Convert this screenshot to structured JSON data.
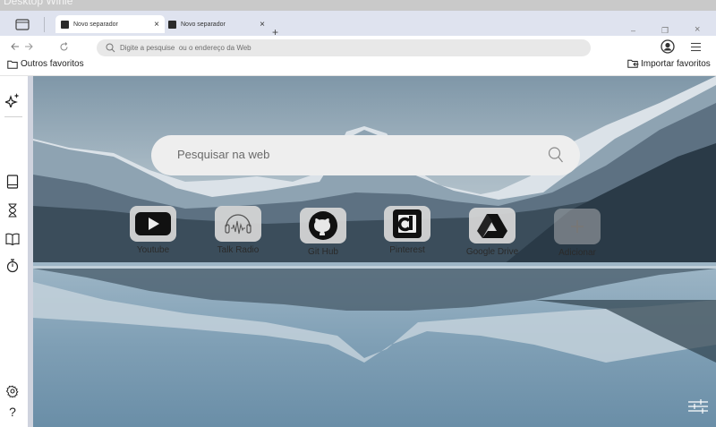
{
  "os": {
    "title": "Desktop Winie"
  },
  "tabs": [
    {
      "label": "Novo separador",
      "active": true
    },
    {
      "label": "Novo separador",
      "active": false
    }
  ],
  "window_controls": {
    "minimize": "–",
    "restore": "❐",
    "close": "×"
  },
  "new_tab_label": "+",
  "close_tab_label": "×",
  "address_bar": {
    "placeholder": "Digite a pesquise  ou o endereço da Web",
    "value": ""
  },
  "bookmarks": {
    "folder": "Outros favoritos",
    "import": "Importar favoritos"
  },
  "sidebar": {
    "top": [
      "sparkle-icon"
    ],
    "middle": [
      "book-icon",
      "hourglass-icon",
      "open-book-icon",
      "timer-icon"
    ],
    "bottom": {
      "settings": "gear-icon",
      "help": "?"
    }
  },
  "search": {
    "placeholder": "Pesquisar na web"
  },
  "shortcuts": [
    {
      "label": "Youtube",
      "icon": "youtube-icon"
    },
    {
      "label": "Talk Radio",
      "icon": "radio-icon"
    },
    {
      "label": "Git Hub",
      "icon": "github-icon"
    },
    {
      "label": "Pinterest",
      "icon": "pinterest-icon"
    },
    {
      "label": "Google Drive",
      "icon": "google-drive-icon"
    },
    {
      "label": "Adicionar",
      "icon": "plus-icon"
    }
  ],
  "colors": {
    "tabstrip": "#dfe3ef",
    "omnibox": "#e8e8e8",
    "sidebar_edge": "#cfd3de",
    "search_box": "#eeeeee"
  }
}
